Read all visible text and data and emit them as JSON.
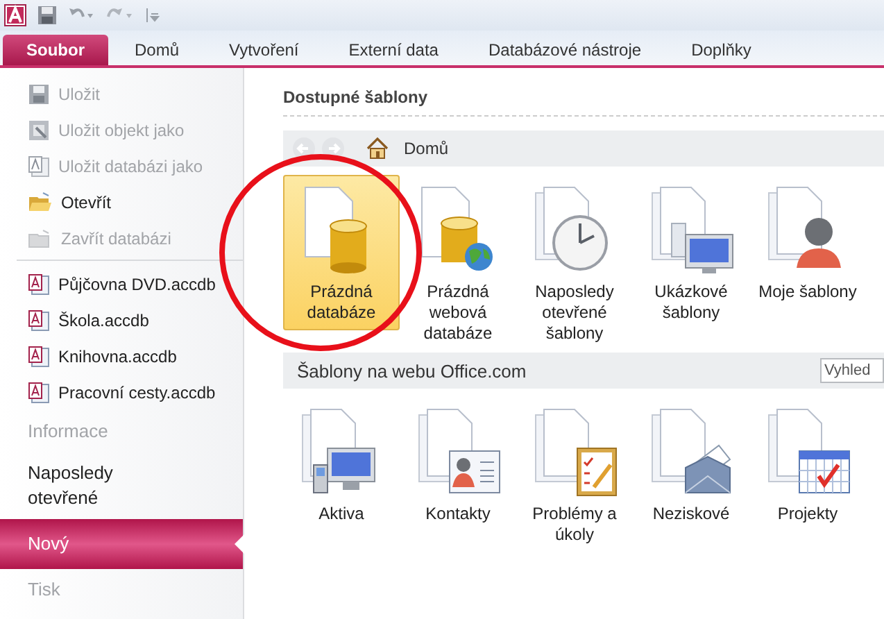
{
  "ribbon": {
    "tabs": [
      {
        "label": "Soubor",
        "selected": true
      },
      {
        "label": "Domů",
        "selected": false
      },
      {
        "label": "Vytvoření",
        "selected": false
      },
      {
        "label": "Externí data",
        "selected": false
      },
      {
        "label": "Databázové nástroje",
        "selected": false
      },
      {
        "label": "Doplňky",
        "selected": false
      }
    ]
  },
  "sidebar": {
    "commands": [
      {
        "label": "Uložit",
        "kind": "save",
        "disabled": true
      },
      {
        "label": "Uložit objekt jako",
        "kind": "save-object",
        "disabled": true
      },
      {
        "label": "Uložit databázi jako",
        "kind": "save-database",
        "disabled": true
      },
      {
        "label": "Otevřít",
        "kind": "open",
        "disabled": false
      },
      {
        "label": "Zavřít databázi",
        "kind": "close",
        "disabled": true
      }
    ],
    "recent_files": [
      {
        "label": "Půjčovna DVD.accdb"
      },
      {
        "label": "Škola.accdb"
      },
      {
        "label": "Knihovna.accdb"
      },
      {
        "label": "Pracovní cesty.accdb"
      }
    ],
    "views": [
      {
        "label": "Informace",
        "selected": false,
        "disabled": true
      },
      {
        "label": "Naposledy otevřené",
        "selected": false,
        "disabled": false
      },
      {
        "label": "Nový",
        "selected": true,
        "disabled": false
      },
      {
        "label": "Tisk",
        "selected": false,
        "disabled": true
      }
    ]
  },
  "main": {
    "heading": "Dostupné šablony",
    "nav": {
      "location": "Domů"
    },
    "templates": [
      {
        "label": "Prázdná databáze",
        "kind": "blank",
        "selected": true
      },
      {
        "label": "Prázdná webová databáze",
        "kind": "web",
        "selected": false
      },
      {
        "label": "Naposledy otevřené šablony",
        "kind": "recent",
        "selected": false
      },
      {
        "label": "Ukázkové šablony",
        "kind": "sample",
        "selected": false
      },
      {
        "label": "Moje šablony",
        "kind": "mine",
        "selected": false
      }
    ],
    "online": {
      "title": "Šablony na webu Office.com",
      "search": {
        "placeholder": "Vyhled"
      },
      "templates": [
        {
          "label": "Aktiva",
          "kind": "assets"
        },
        {
          "label": "Kontakty",
          "kind": "contacts"
        },
        {
          "label": "Problémy a úkoly",
          "kind": "issues"
        },
        {
          "label": "Neziskové",
          "kind": "nonprofit"
        },
        {
          "label": "Projekty",
          "kind": "projects"
        }
      ]
    }
  }
}
